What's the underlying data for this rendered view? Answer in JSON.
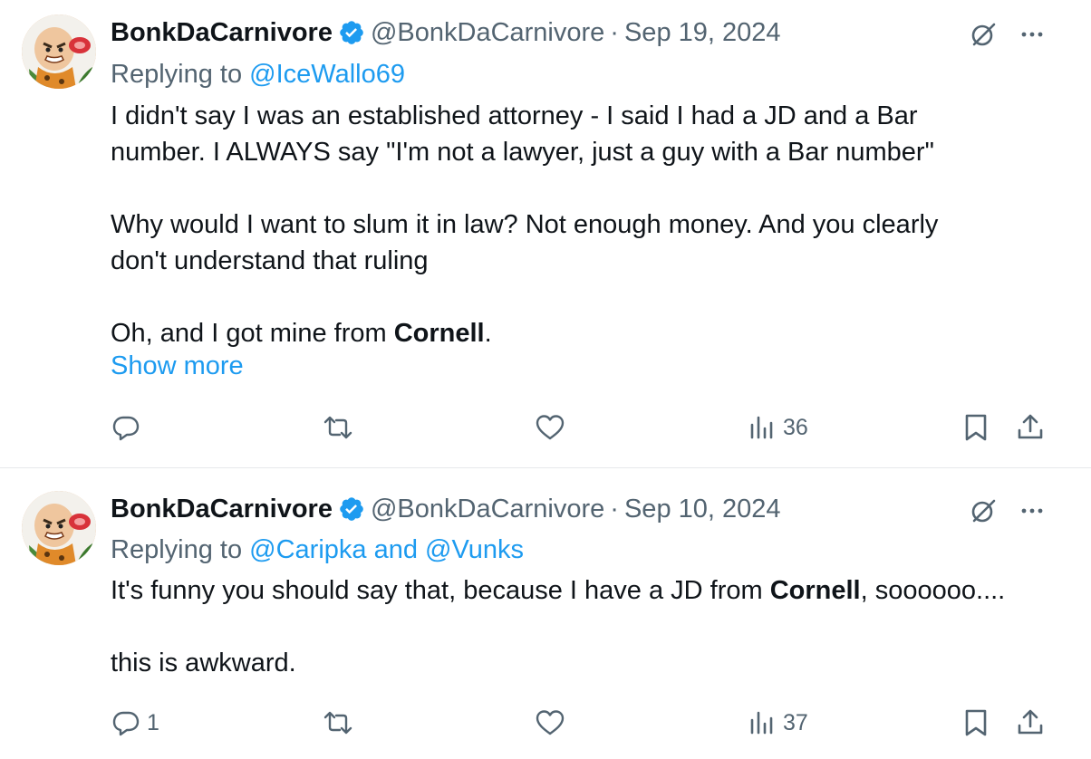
{
  "tweets": [
    {
      "author": {
        "name": "BonkDaCarnivore",
        "handle": "@BonkDaCarnivore",
        "verified": true
      },
      "separator": "·",
      "date": "Sep 19, 2024",
      "replying_prefix": "Replying to ",
      "replying_to": "@IceWallo69",
      "lines": [
        {
          "text": "I didn't say I was an established attorney - I said I had a JD and a Bar"
        },
        {
          "text": "number.  I ALWAYS say \"I'm not a lawyer, just a guy with a Bar number\""
        },
        {
          "text": ""
        },
        {
          "text": "Why would I want to slum it in law?  Not enough money.  And you clearly"
        },
        {
          "text": "don't understand that ruling"
        },
        {
          "text": ""
        },
        {
          "pre": "Oh, and I got mine from ",
          "bold": "Cornell",
          "post": "."
        }
      ],
      "show_more": "Show more",
      "stats": {
        "replies": "",
        "retweets": "",
        "likes": "",
        "views": "36"
      }
    },
    {
      "author": {
        "name": "BonkDaCarnivore",
        "handle": "@BonkDaCarnivore",
        "verified": true
      },
      "separator": "·",
      "date": "Sep 10, 2024",
      "replying_prefix": "Replying to ",
      "replying_to": "@Caripka and @Vunks",
      "lines": [
        {
          "pre": "It's funny you should say that, because I have a JD from ",
          "bold": "Cornell",
          "post": ", soooooo...."
        },
        {
          "text": ""
        },
        {
          "text": "this is awkward."
        }
      ],
      "stats": {
        "replies": "1",
        "retweets": "",
        "likes": "",
        "views": "37"
      }
    }
  ],
  "icons": {
    "verified": "verified-badge-icon",
    "grok": "grok-icon",
    "more": "more-icon",
    "reply": "reply-icon",
    "retweet": "retweet-icon",
    "like": "heart-icon",
    "views": "views-icon",
    "bookmark": "bookmark-icon",
    "share": "share-icon"
  },
  "colors": {
    "text": "#0f1419",
    "secondary": "#536471",
    "link": "#1d9bf0",
    "verified": "#1d9bf0",
    "divider": "#e6e9eb"
  }
}
